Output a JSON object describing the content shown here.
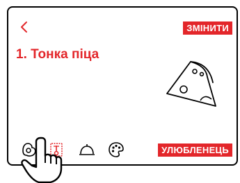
{
  "header": {
    "back_icon": "chevron-left-icon",
    "change_label": "ЗМІНИТИ"
  },
  "program": {
    "title": "1. Тонка піца",
    "image_icon": "pizza-slice-icon"
  },
  "toolbar": {
    "icons": [
      "egg-icon",
      "thermometer-timer-icon",
      "cloche-icon",
      "palette-icon"
    ],
    "favorite_label": "УЛЮБЛЕНЕЦЬ"
  },
  "colors": {
    "accent": "#e3262a",
    "frame": "#000000",
    "background": "#ffffff"
  }
}
